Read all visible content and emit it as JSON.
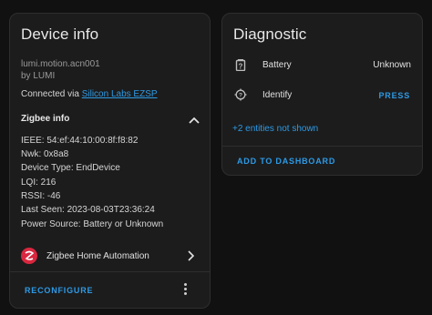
{
  "device_card": {
    "title": "Device info",
    "model": "lumi.motion.acn001",
    "manufacturer": "by LUMI",
    "connected_prefix": "Connected via ",
    "connected_link": "Silicon Labs EZSP",
    "zigbee_info_title": "Zigbee info",
    "zigbee_lines": [
      "IEEE: 54:ef:44:10:00:8f:f8:82",
      "Nwk: 0x8a8",
      "Device Type: EndDevice",
      "LQI: 216",
      "RSSI: -46",
      "Last Seen: 2023-08-03T23:36:24",
      "Power Source: Battery or Unknown"
    ],
    "integration_label": "Zigbee Home Automation",
    "reconfigure_label": "RECONFIGURE"
  },
  "diagnostic_card": {
    "title": "Diagnostic",
    "rows": [
      {
        "label": "Battery",
        "value": "Unknown",
        "icon": "battery-unknown-icon"
      },
      {
        "label": "Identify",
        "value": "PRESS",
        "icon": "identify-icon"
      }
    ],
    "hidden_entities": "+2 entities not shown",
    "add_to_dashboard_label": "ADD TO DASHBOARD"
  },
  "colors": {
    "accent": "#2d9ae6",
    "card_bg": "#1c1c1c",
    "page_bg": "#111111",
    "zha_brand": "#d9273f"
  }
}
